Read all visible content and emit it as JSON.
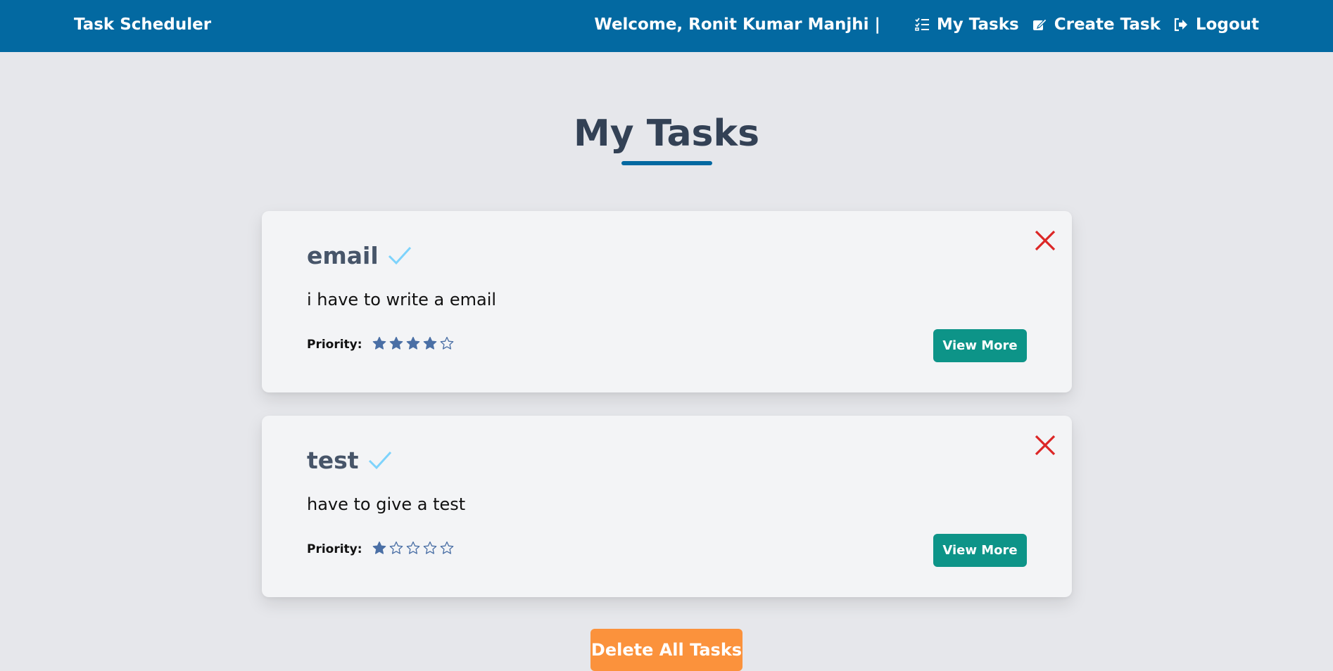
{
  "navbar": {
    "brand": "Task Scheduler",
    "welcome": "Welcome, Ronit Kumar Manjhi |",
    "links": [
      {
        "label": "My Tasks",
        "icon": "checklist-icon"
      },
      {
        "label": "Create Task",
        "icon": "edit-icon"
      },
      {
        "label": "Logout",
        "icon": "logout-icon"
      }
    ],
    "color": "#0369a1"
  },
  "page": {
    "title": "My Tasks"
  },
  "tasks": [
    {
      "title": "email",
      "description": "i have to write a email",
      "priority_label": "Priority:",
      "priority": 4,
      "priority_max": 5,
      "button_label": "View More"
    },
    {
      "title": "test",
      "description": "have to give a test",
      "priority_label": "Priority:",
      "priority": 1,
      "priority_max": 5,
      "button_label": "View More"
    }
  ],
  "actions": {
    "delete_all_label": "Delete All Tasks"
  },
  "colors": {
    "accent": "#0369a1",
    "view_button": "#0d9488",
    "delete_button": "#fb923c",
    "close": "#dc2626",
    "check": "#7dd3fc",
    "star": "#4a6fa5"
  }
}
